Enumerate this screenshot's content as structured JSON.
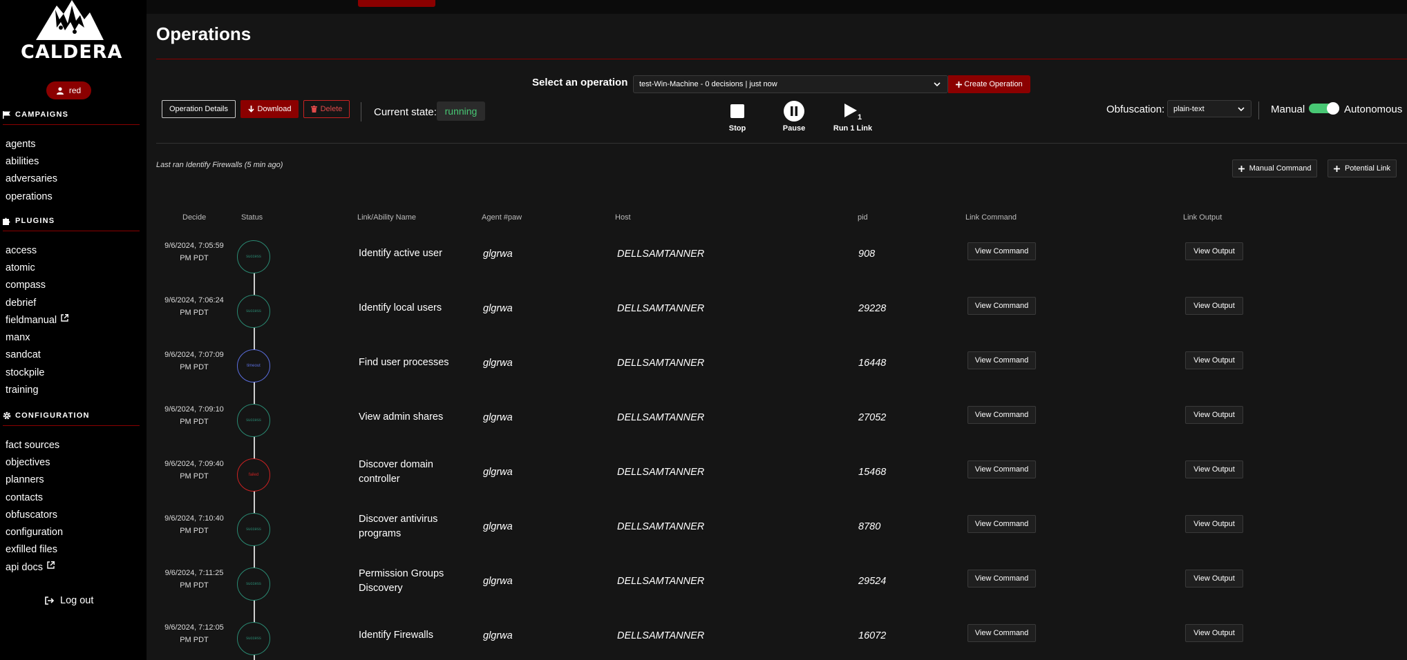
{
  "brand": {
    "logo_text": "CALDERA"
  },
  "user": {
    "name": "red"
  },
  "sidebar": {
    "campaigns": {
      "title": "CAMPAIGNS",
      "items": [
        "agents",
        "abilities",
        "adversaries",
        "operations"
      ]
    },
    "plugins": {
      "title": "PLUGINS",
      "items": [
        "access",
        "atomic",
        "compass",
        "debrief",
        "fieldmanual",
        "manx",
        "sandcat",
        "stockpile",
        "training"
      ]
    },
    "configuration": {
      "title": "CONFIGURATION",
      "items": [
        "fact sources",
        "objectives",
        "planners",
        "contacts",
        "obfuscators",
        "configuration",
        "exfilled files",
        "api docs"
      ]
    },
    "logout": "Log out"
  },
  "page": {
    "title": "Operations"
  },
  "operation_select": {
    "label": "Select an operation",
    "value": "test-Win-Machine - 0 decisions | just now",
    "create_label": "Create Operation"
  },
  "toolbar": {
    "details_label": "Operation Details",
    "download_label": "Download",
    "delete_label": "Delete",
    "state_label": "Current state:",
    "state_value": "running",
    "stop_label": "Stop",
    "pause_label": "Pause",
    "run_label": "Run 1 Link",
    "obfuscation_label": "Obfuscation:",
    "obfuscation_value": "plain-text",
    "manual_label": "Manual",
    "autonomous_label": "Autonomous"
  },
  "last_ran": "Last ran Identify Firewalls (5 min ago)",
  "actions": {
    "manual_command": "Manual Command",
    "potential_link": "Potential Link"
  },
  "table": {
    "headers": {
      "decide": "Decide",
      "status": "Status",
      "name": "Link/Ability Name",
      "paw": "Agent #paw",
      "host": "Host",
      "pid": "pid",
      "command": "Link Command",
      "output": "Link Output"
    },
    "view_command": "View Command",
    "view_output": "View Output",
    "rows": [
      {
        "date_line1": "9/6/2024, 7:05:59",
        "date_line2": "PM PDT",
        "status": "success",
        "name": "Identify active user",
        "paw": "glgrwa",
        "host": "DELLSAMTANNER",
        "pid": "908"
      },
      {
        "date_line1": "9/6/2024, 7:06:24",
        "date_line2": "PM PDT",
        "status": "success",
        "name": "Identify local users",
        "paw": "glgrwa",
        "host": "DELLSAMTANNER",
        "pid": "29228"
      },
      {
        "date_line1": "9/6/2024, 7:07:09",
        "date_line2": "PM PDT",
        "status": "timeout",
        "name": "Find user processes",
        "paw": "glgrwa",
        "host": "DELLSAMTANNER",
        "pid": "16448"
      },
      {
        "date_line1": "9/6/2024, 7:09:10",
        "date_line2": "PM PDT",
        "status": "success",
        "name": "View admin shares",
        "paw": "glgrwa",
        "host": "DELLSAMTANNER",
        "pid": "27052"
      },
      {
        "date_line1": "9/6/2024, 7:09:40",
        "date_line2": "PM PDT",
        "status": "failed",
        "name": "Discover domain controller",
        "paw": "glgrwa",
        "host": "DELLSAMTANNER",
        "pid": "15468"
      },
      {
        "date_line1": "9/6/2024, 7:10:40",
        "date_line2": "PM PDT",
        "status": "success",
        "name": "Discover antivirus programs",
        "paw": "glgrwa",
        "host": "DELLSAMTANNER",
        "pid": "8780"
      },
      {
        "date_line1": "9/6/2024, 7:11:25",
        "date_line2": "PM PDT",
        "status": "success",
        "name": "Permission Groups Discovery",
        "paw": "glgrwa",
        "host": "DELLSAMTANNER",
        "pid": "29524"
      },
      {
        "date_line1": "9/6/2024, 7:12:05",
        "date_line2": "PM PDT",
        "status": "success",
        "name": "Identify Firewalls",
        "paw": "glgrwa",
        "host": "DELLSAMTANNER",
        "pid": "16072"
      }
    ]
  },
  "colors": {
    "accent": "#8b0000",
    "success": "#2a8a73",
    "timeout": "#5b6fe0",
    "failed": "#cc2222",
    "running": "#48c774"
  }
}
